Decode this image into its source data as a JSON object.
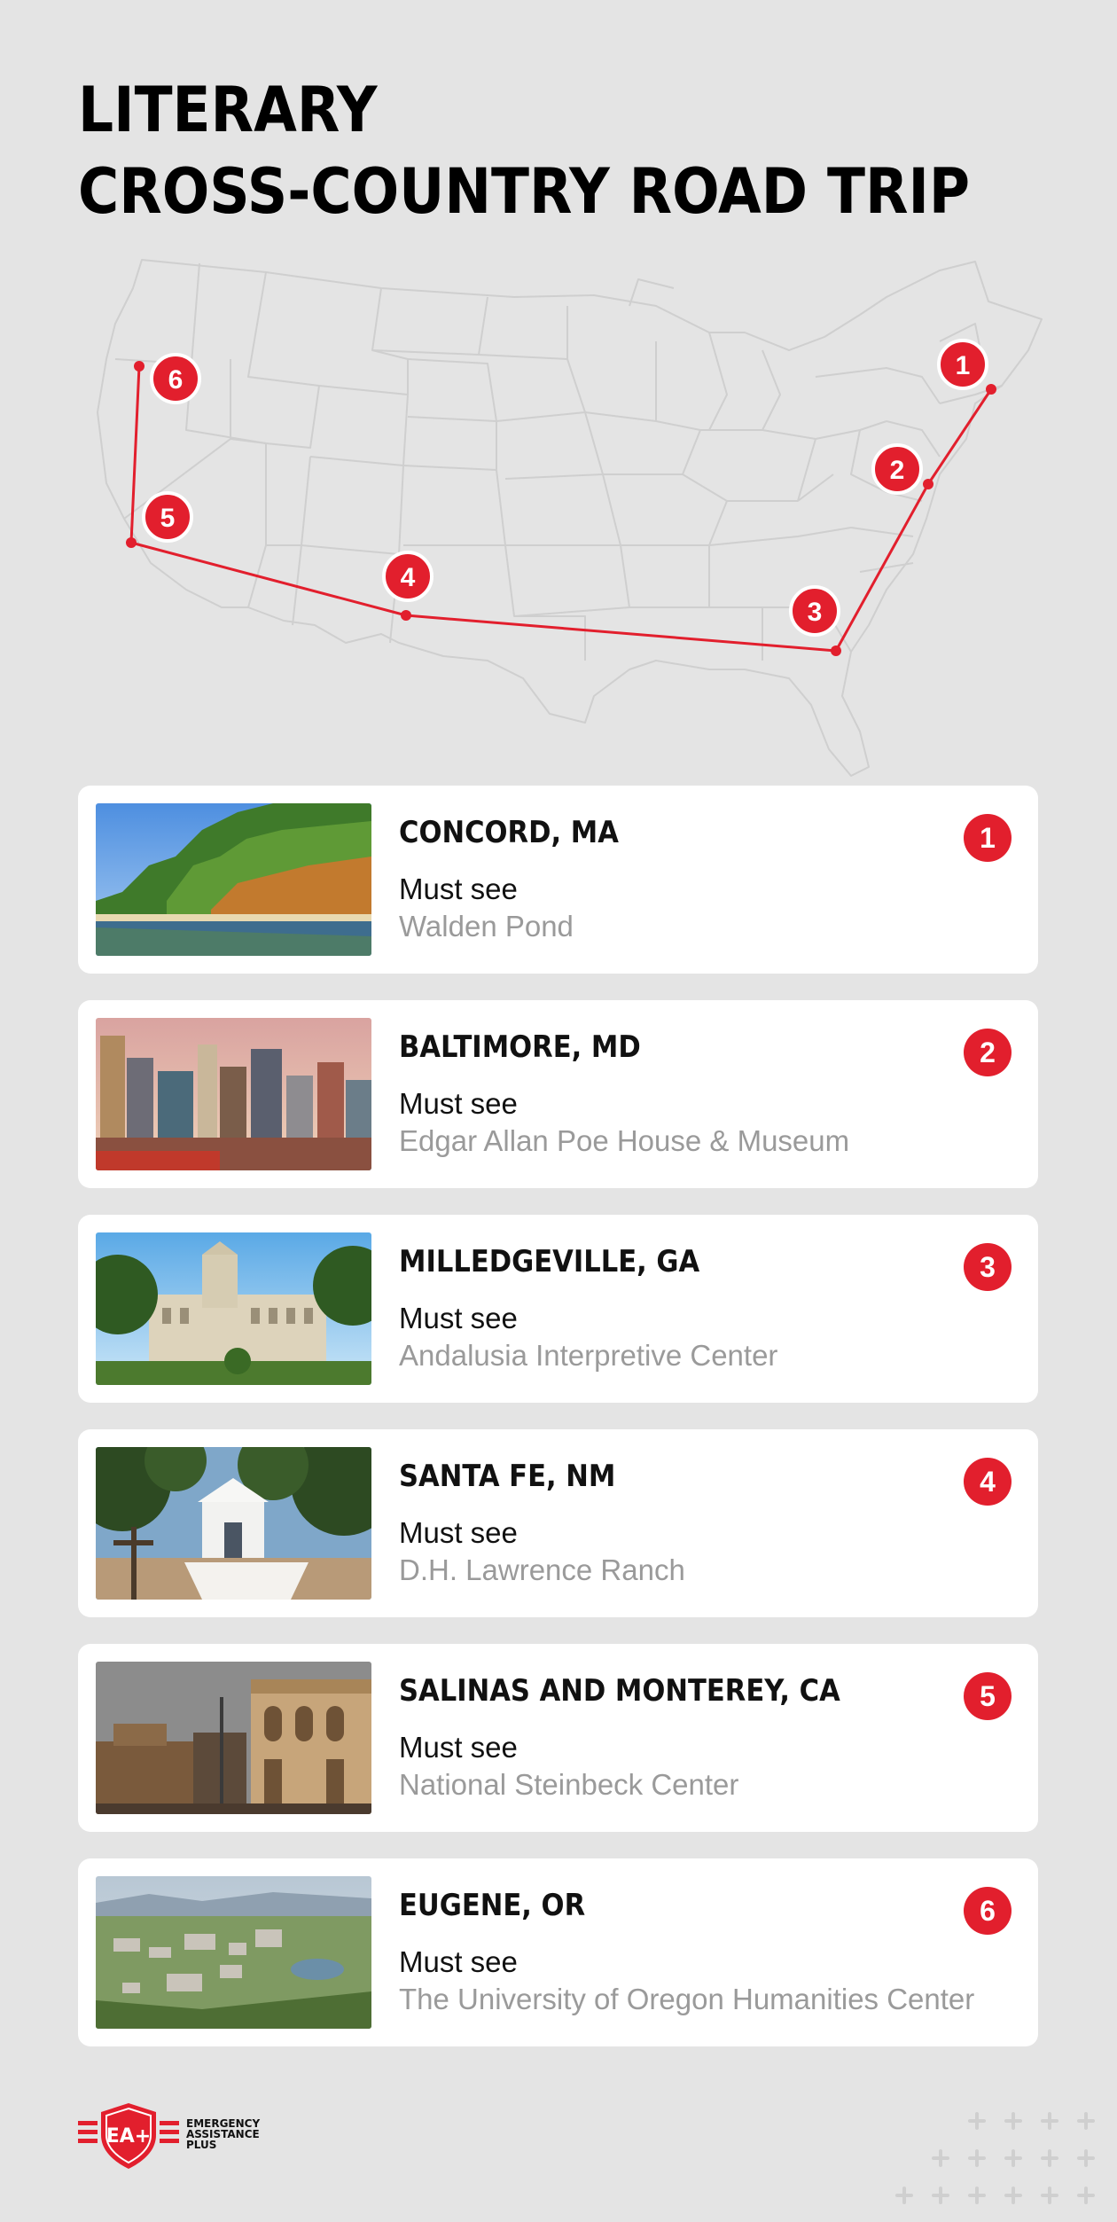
{
  "title": {
    "line1": "LITERARY",
    "line2": "CROSS-COUNTRY ROAD TRIP"
  },
  "colors": {
    "accent": "#e21f2d",
    "background": "#e4e4e4",
    "card": "#ffffff",
    "muted": "#9a9a9a"
  },
  "map": {
    "markers": [
      "1",
      "2",
      "3",
      "4",
      "5",
      "6"
    ]
  },
  "stops": [
    {
      "number": "1",
      "city": "CONCORD, MA",
      "must_see_label": "Must see",
      "place": "Walden Pond",
      "photo": "pond-forest"
    },
    {
      "number": "2",
      "city": "BALTIMORE, MD",
      "must_see_label": "Must see",
      "place": "Edgar Allan Poe House & Museum",
      "photo": "city-skyline"
    },
    {
      "number": "3",
      "city": "MILLEDGEVILLE, GA",
      "must_see_label": "Must see",
      "place": "Andalusia Interpretive Center",
      "photo": "historic-building"
    },
    {
      "number": "4",
      "city": "SANTA FE, NM",
      "must_see_label": "Must see",
      "place": "D.H. Lawrence Ranch",
      "photo": "white-chapel-forest"
    },
    {
      "number": "5",
      "city": "SALINAS AND MONTEREY, CA",
      "must_see_label": "Must see",
      "place": "National Steinbeck Center",
      "photo": "old-town-buildings"
    },
    {
      "number": "6",
      "city": "EUGENE, OR",
      "must_see_label": "Must see",
      "place": "The University of Oregon Humanities Center",
      "photo": "aerial-town"
    }
  ],
  "footer": {
    "logo_lines": [
      "EMERGENCY",
      "ASSISTANCE",
      "PLUS"
    ],
    "logo_mark": "EA+"
  }
}
